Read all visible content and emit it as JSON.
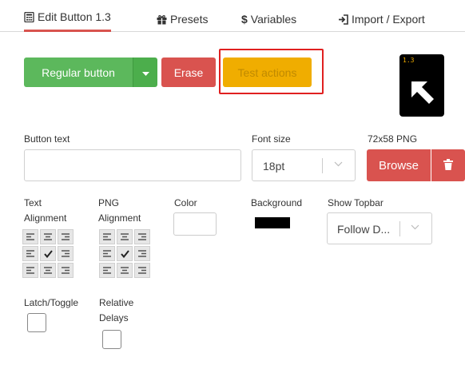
{
  "tabs": [
    {
      "label": "Edit Button 1.3",
      "icon": "calculator-icon"
    },
    {
      "label": "Presets",
      "icon": "gift-icon"
    },
    {
      "label": "Variables",
      "icon": "dollar-icon"
    },
    {
      "label": "Import / Export",
      "icon": "sign-in-icon"
    }
  ],
  "actions": {
    "regular_label": "Regular button",
    "erase_label": "Erase",
    "test_label": "Test actions"
  },
  "preview": {
    "corner_text": "1.3",
    "icon": "arrow-up-left-icon"
  },
  "form": {
    "button_text_label": "Button text",
    "button_text_value": "",
    "font_size_label": "Font size",
    "font_size_value": "18pt",
    "png_label": "72x58 PNG",
    "browse_label": "Browse",
    "text_alignment_label_1": "Text",
    "text_alignment_label_2": "Alignment",
    "png_alignment_label_1": "PNG",
    "png_alignment_label_2": "Alignment",
    "color_label": "Color",
    "background_label": "Background",
    "show_topbar_label": "Show Topbar",
    "show_topbar_value": "Follow D...",
    "latch_label": "Latch/Toggle",
    "relative_label_1": "Relative",
    "relative_label_2": "Delays"
  },
  "colors": {
    "text_color": "#ffffff",
    "background_color": "#000000",
    "accent_red": "#d9534f",
    "accent_green": "#5cb85c",
    "accent_yellow": "#f0ad00"
  }
}
